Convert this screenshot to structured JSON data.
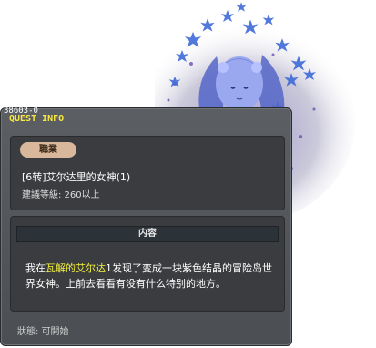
{
  "quest": {
    "id": "38603-0",
    "tab_label": "QUEST INFO",
    "job_badge": "職業",
    "title": "[6转]艾尔达里的女神(1)",
    "level_requirement": "建議等級: 260以上",
    "content_header": "内容",
    "description": {
      "part1": "我在",
      "highlight": "瓦解的艾尔达",
      "part2": "1发现了变成一块紫色结晶的冒险岛世界女神。上前去看看有没有什么特别的地方。"
    },
    "status": "狀態: 可開始"
  },
  "colors": {
    "window_bg": "#55595d",
    "card_bg": "#3a3c3f",
    "title_yellow": "#f6e742",
    "highlight_yellow": "#f2ee41",
    "badge_bg": "#d9b79a",
    "goddess_blue": "#4a58b8"
  },
  "icons": {
    "character": "goddess-portrait",
    "particles": "maple-leaf-sparkles"
  }
}
